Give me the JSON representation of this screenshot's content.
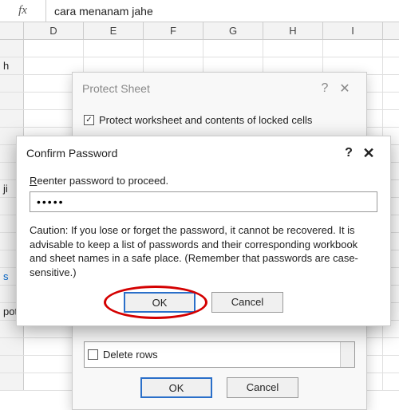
{
  "formula": {
    "fx": "fx",
    "value": "cara menanam jahe"
  },
  "cols": [
    "D",
    "E",
    "F",
    "G",
    "H",
    "I"
  ],
  "leftcells": {
    "r1": "h",
    "r8": "ji",
    "r9": "",
    "r13": "s",
    "r15": "pot",
    "r16": ""
  },
  "protect": {
    "title": "Protect Sheet",
    "q": "?",
    "x": "✕",
    "chk1": "Protect worksheet and contents of locked cells",
    "optVisible": "Delete rows",
    "ok": "OK",
    "cancel": "Cancel"
  },
  "confirm": {
    "title": "Confirm Password",
    "q": "?",
    "x": "✕",
    "label_u": "R",
    "label_rest": "eenter password to proceed.",
    "pwd": "•••••",
    "caution": "Caution: If you lose or forget the password, it cannot be recovered. It is advisable to keep a list of passwords and their corresponding workbook and sheet names in a safe place.  (Remember that passwords are case-sensitive.)",
    "ok": "OK",
    "cancel": "Cancel"
  }
}
